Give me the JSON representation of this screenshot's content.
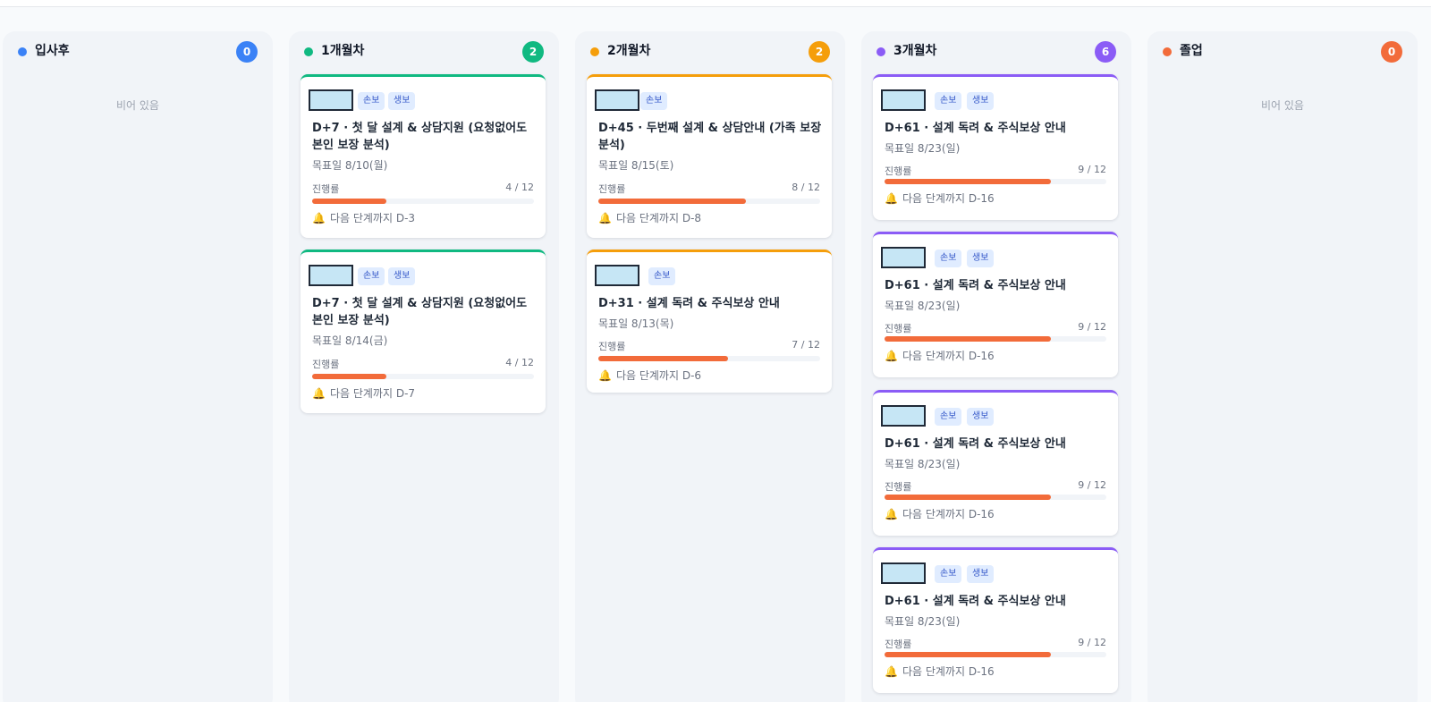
{
  "colors": {
    "blue": "#3b82f6",
    "green": "#10b981",
    "orange": "#f59e0b",
    "purple": "#8b5cf6",
    "red_orange": "#f26b3a",
    "progress_fill": "#f26b3a"
  },
  "columns": [
    {
      "title": "입사후",
      "count": "0",
      "empty_label": "비어 있음"
    },
    {
      "title": "1개월차",
      "count": "2"
    },
    {
      "title": "2개월차",
      "count": "2"
    },
    {
      "title": "3개월차",
      "count": "6"
    },
    {
      "title": "졸업",
      "count": "0",
      "empty_label": "비어 있음"
    }
  ],
  "cards": [
    {
      "column": "1개월차",
      "tags": [
        "손보",
        "생보"
      ],
      "title": "D+7 · 첫 달 설계 & 상담지원 (요청없어도 본인 보장 분석)",
      "date": "목표일 8/10(월)",
      "progress_label": "진행률",
      "progress_text": "4 / 12",
      "progress": 0.3333,
      "next": "다음 단계까지 D-3"
    },
    {
      "column": "1개월차",
      "tags": [
        "손보",
        "생보"
      ],
      "title": "D+7 · 첫 달 설계 & 상담지원 (요청없어도 본인 보장 분석)",
      "date": "목표일 8/14(금)",
      "progress_label": "진행률",
      "progress_text": "4 / 12",
      "progress": 0.3333,
      "next": "다음 단계까지 D-7"
    },
    {
      "column": "2개월차",
      "tags": [
        "손보"
      ],
      "title": "D+45 · 두번째 설계 & 상담안내 (가족 보장 분석)",
      "date": "목표일 8/15(토)",
      "progress_label": "진행률",
      "progress_text": "8 / 12",
      "progress": 0.6667,
      "next": "다음 단계까지 D-8"
    },
    {
      "column": "2개월차",
      "tags": [
        "손보"
      ],
      "title": "D+31 · 설계 독려 & 주식보상 안내",
      "date": "목표일 8/13(목)",
      "progress_label": "진행률",
      "progress_text": "7 / 12",
      "progress": 0.5833,
      "next": "다음 단계까지 D-6"
    },
    {
      "column": "3개월차",
      "tags": [
        "손보",
        "생보"
      ],
      "title": "D+61 · 설계 독려 & 주식보상 안내",
      "date": "목표일 8/23(일)",
      "progress_label": "진행률",
      "progress_text": "9 / 12",
      "progress": 0.75,
      "next": "다음 단계까지 D-16"
    },
    {
      "column": "3개월차",
      "tags": [
        "손보",
        "생보"
      ],
      "title": "D+61 · 설계 독려 & 주식보상 안내",
      "date": "목표일 8/23(일)",
      "progress_label": "진행률",
      "progress_text": "9 / 12",
      "progress": 0.75,
      "next": "다음 단계까지 D-16"
    },
    {
      "column": "3개월차",
      "tags": [
        "손보",
        "생보"
      ],
      "title": "D+61 · 설계 독려 & 주식보상 안내",
      "date": "목표일 8/23(일)",
      "progress_label": "진행률",
      "progress_text": "9 / 12",
      "progress": 0.75,
      "next": "다음 단계까지 D-16"
    },
    {
      "column": "3개월차",
      "tags": [
        "손보",
        "생보"
      ],
      "title": "D+61 · 설계 독려 & 주식보상 안내",
      "date": "목표일 8/23(일)",
      "progress_label": "진행률",
      "progress_text": "9 / 12",
      "progress": 0.75,
      "next": "다음 단계까지 D-16"
    }
  ]
}
